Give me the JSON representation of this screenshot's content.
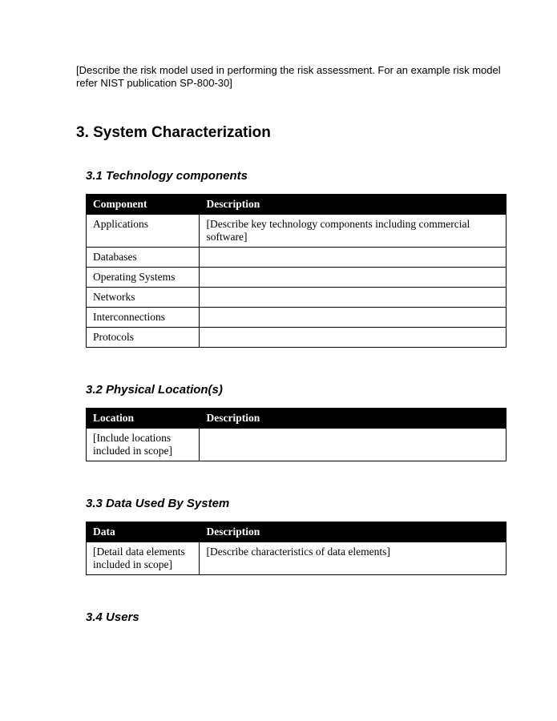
{
  "intro": "[Describe the risk model used in performing the risk assessment. For an example risk model refer NIST publication SP-800-30]",
  "section_heading": "3. System Characterization",
  "sub31": {
    "heading": "3.1 Technology components",
    "headers": {
      "c1": "Component",
      "c2": "Description"
    },
    "rows": [
      {
        "c1": "Applications",
        "c2": "[Describe key technology components including commercial software]"
      },
      {
        "c1": "Databases",
        "c2": ""
      },
      {
        "c1": "Operating Systems",
        "c2": ""
      },
      {
        "c1": "Networks",
        "c2": ""
      },
      {
        "c1": "Interconnections",
        "c2": ""
      },
      {
        "c1": "Protocols",
        "c2": ""
      }
    ]
  },
  "sub32": {
    "heading": "3.2 Physical Location(s)",
    "headers": {
      "c1": "Location",
      "c2": "Description"
    },
    "rows": [
      {
        "c1": "[Include locations included in scope]",
        "c2": ""
      }
    ]
  },
  "sub33": {
    "heading": "3.3 Data Used By System",
    "headers": {
      "c1": "Data",
      "c2": "Description"
    },
    "rows": [
      {
        "c1": "[Detail data elements included in scope]",
        "c2": "[Describe characteristics of data elements]"
      }
    ]
  },
  "sub34": {
    "heading": "3.4 Users"
  }
}
